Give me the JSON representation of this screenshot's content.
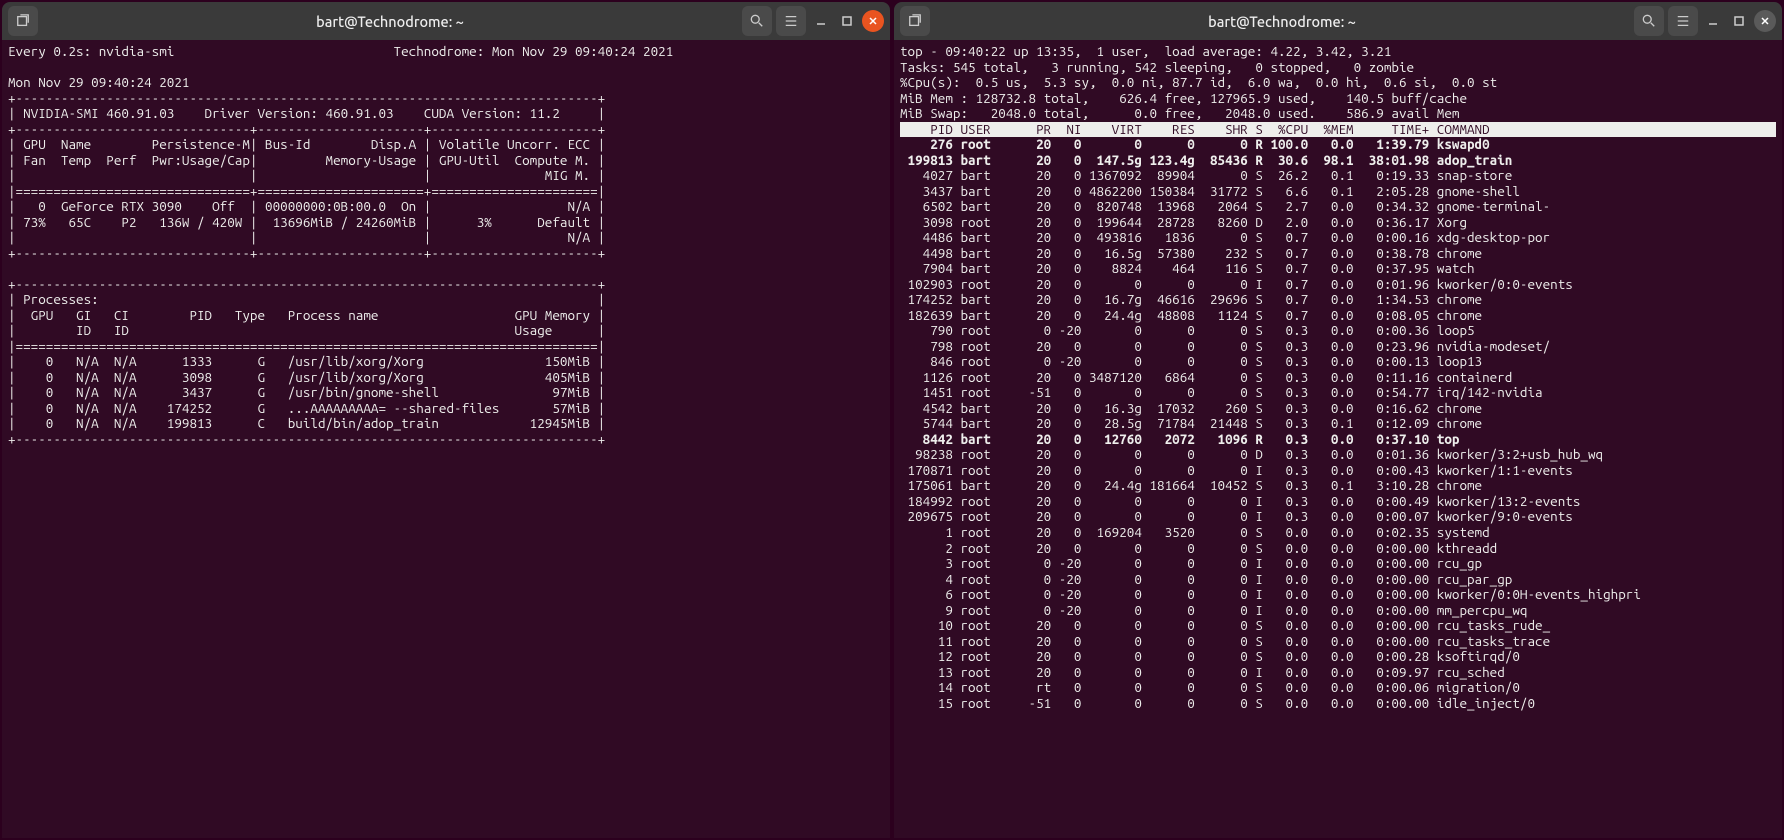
{
  "left": {
    "title": "bart@Technodrome: ~",
    "watch_line_l": "Every 0.2s: nvidia-smi",
    "watch_line_r": "Technodrome: Mon Nov 29 09:40:24 2021",
    "date_line": "Mon Nov 29 09:40:24 2021",
    "smi_header": " NVIDIA-SMI 460.91.03    Driver Version: 460.91.03    CUDA Version: 11.2     ",
    "gpu_hdr1": " GPU  Name        Persistence-M| Bus-Id        Disp.A | Volatile Uncorr. ECC ",
    "gpu_hdr2": " Fan  Temp  Perf  Pwr:Usage/Cap|         Memory-Usage | GPU-Util  Compute M. ",
    "gpu_hdr3": "                               |                      |               MIG M. ",
    "gpu_row1": "   0  GeForce RTX 3090    Off  | 00000000:0B:00.0  On |                  N/A ",
    "gpu_row2": " 73%   65C    P2   136W / 420W |  13696MiB / 24260MiB |      3%      Default ",
    "gpu_row3": "                               |                      |                  N/A ",
    "proc_label": " Processes:                                                                  ",
    "proc_hdr1": "  GPU   GI   CI        PID   Type   Process name                  GPU Memory ",
    "proc_hdr2": "        ID   ID                                                   Usage      ",
    "procs": [
      "    0   N/A  N/A      1333      G   /usr/lib/xorg/Xorg                150MiB ",
      "    0   N/A  N/A      3098      G   /usr/lib/xorg/Xorg                405MiB ",
      "    0   N/A  N/A      3437      G   /usr/bin/gnome-shell               97MiB ",
      "    0   N/A  N/A    174252      G   ...AAAAAAAAA= --shared-files       57MiB ",
      "    0   N/A  N/A    199813      C   build/bin/adop_train            12945MiB "
    ]
  },
  "right": {
    "title": "bart@Technodrome: ~",
    "top_line": "top - 09:40:22 up 13:35,  1 user,  load average: 4.22, 3.42, 3.21",
    "tasks_line": "Tasks: 545 total,   3 running, 542 sleeping,   0 stopped,   0 zombie",
    "cpu_line": "%Cpu(s):  0.5 us,  5.3 sy,  0.0 ni, 87.7 id,  6.0 wa,  0.0 hi,  0.6 si,  0.0 st",
    "mem_line": "MiB Mem : 128732.8 total,    626.4 free, 127965.9 used,    140.5 buff/cache",
    "swap_line": "MiB Swap:   2048.0 total,      0.0 free,   2048.0 used.    586.9 avail Mem ",
    "header": "    PID USER      PR  NI    VIRT    RES    SHR S  %CPU  %MEM     TIME+ COMMAND                                                                                                ",
    "rows": [
      {
        "b": true,
        "t": "    276 root      20   0       0      0      0 R 100.0   0.0   1:39.79 kswapd0"
      },
      {
        "b": true,
        "t": " 199813 bart      20   0  147.5g 123.4g  85436 R  30.6  98.1  38:01.98 adop_train"
      },
      {
        "b": false,
        "t": "   4027 bart      20   0 1367092  89904      0 S  26.2   0.1   0:19.33 snap-store"
      },
      {
        "b": false,
        "t": "   3437 bart      20   0 4862200 150384  31772 S   6.6   0.1   2:05.28 gnome-shell"
      },
      {
        "b": false,
        "t": "   6502 bart      20   0  820748  13968   2064 S   2.7   0.0   0:34.32 gnome-terminal-"
      },
      {
        "b": false,
        "t": "   3098 root      20   0  199644  28728   8260 D   2.0   0.0   0:36.17 Xorg"
      },
      {
        "b": false,
        "t": "   4486 bart      20   0  493816   1836      0 S   0.7   0.0   0:00.16 xdg-desktop-por"
      },
      {
        "b": false,
        "t": "   4498 bart      20   0   16.5g  57380    232 S   0.7   0.0   0:38.78 chrome"
      },
      {
        "b": false,
        "t": "   7904 bart      20   0    8824    464    116 S   0.7   0.0   0:37.95 watch"
      },
      {
        "b": false,
        "t": " 102903 root      20   0       0      0      0 I   0.7   0.0   0:01.96 kworker/0:0-events"
      },
      {
        "b": false,
        "t": " 174252 bart      20   0   16.7g  46616  29696 S   0.7   0.0   1:34.53 chrome"
      },
      {
        "b": false,
        "t": " 182639 bart      20   0   24.4g  48808   1124 S   0.7   0.0   0:08.05 chrome"
      },
      {
        "b": false,
        "t": "    790 root       0 -20       0      0      0 S   0.3   0.0   0:00.36 loop5"
      },
      {
        "b": false,
        "t": "    798 root      20   0       0      0      0 S   0.3   0.0   0:23.96 nvidia-modeset/"
      },
      {
        "b": false,
        "t": "    846 root       0 -20       0      0      0 S   0.3   0.0   0:00.13 loop13"
      },
      {
        "b": false,
        "t": "   1126 root      20   0 3487120   6864      0 S   0.3   0.0   0:11.16 containerd"
      },
      {
        "b": false,
        "t": "   1451 root     -51   0       0      0      0 S   0.3   0.0   0:54.77 irq/142-nvidia"
      },
      {
        "b": false,
        "t": "   4542 bart      20   0   16.3g  17032    260 S   0.3   0.0   0:16.62 chrome"
      },
      {
        "b": false,
        "t": "   5744 bart      20   0   28.5g  71784  21448 S   0.3   0.1   0:12.09 chrome"
      },
      {
        "b": true,
        "t": "   8442 bart      20   0   12760   2072   1096 R   0.3   0.0   0:37.10 top"
      },
      {
        "b": false,
        "t": "  98238 root      20   0       0      0      0 D   0.3   0.0   0:01.36 kworker/3:2+usb_hub_wq"
      },
      {
        "b": false,
        "t": " 170871 root      20   0       0      0      0 I   0.3   0.0   0:00.43 kworker/1:1-events"
      },
      {
        "b": false,
        "t": " 175061 bart      20   0   24.4g 181664  10452 S   0.3   0.1   3:10.28 chrome"
      },
      {
        "b": false,
        "t": " 184992 root      20   0       0      0      0 I   0.3   0.0   0:00.49 kworker/13:2-events"
      },
      {
        "b": false,
        "t": " 209675 root      20   0       0      0      0 I   0.3   0.0   0:00.07 kworker/9:0-events"
      },
      {
        "b": false,
        "t": "      1 root      20   0  169204   3520      0 S   0.0   0.0   0:02.35 systemd"
      },
      {
        "b": false,
        "t": "      2 root      20   0       0      0      0 S   0.0   0.0   0:00.00 kthreadd"
      },
      {
        "b": false,
        "t": "      3 root       0 -20       0      0      0 I   0.0   0.0   0:00.00 rcu_gp"
      },
      {
        "b": false,
        "t": "      4 root       0 -20       0      0      0 I   0.0   0.0   0:00.00 rcu_par_gp"
      },
      {
        "b": false,
        "t": "      6 root       0 -20       0      0      0 I   0.0   0.0   0:00.00 kworker/0:0H-events_highpri"
      },
      {
        "b": false,
        "t": "      9 root       0 -20       0      0      0 I   0.0   0.0   0:00.00 mm_percpu_wq"
      },
      {
        "b": false,
        "t": "     10 root      20   0       0      0      0 S   0.0   0.0   0:00.00 rcu_tasks_rude_"
      },
      {
        "b": false,
        "t": "     11 root      20   0       0      0      0 S   0.0   0.0   0:00.00 rcu_tasks_trace"
      },
      {
        "b": false,
        "t": "     12 root      20   0       0      0      0 S   0.0   0.0   0:00.28 ksoftirqd/0"
      },
      {
        "b": false,
        "t": "     13 root      20   0       0      0      0 I   0.0   0.0   0:09.97 rcu_sched"
      },
      {
        "b": false,
        "t": "     14 root      rt   0       0      0      0 S   0.0   0.0   0:00.06 migration/0"
      },
      {
        "b": false,
        "t": "     15 root     -51   0       0      0      0 S   0.0   0.0   0:00.00 idle_inject/0"
      }
    ]
  }
}
